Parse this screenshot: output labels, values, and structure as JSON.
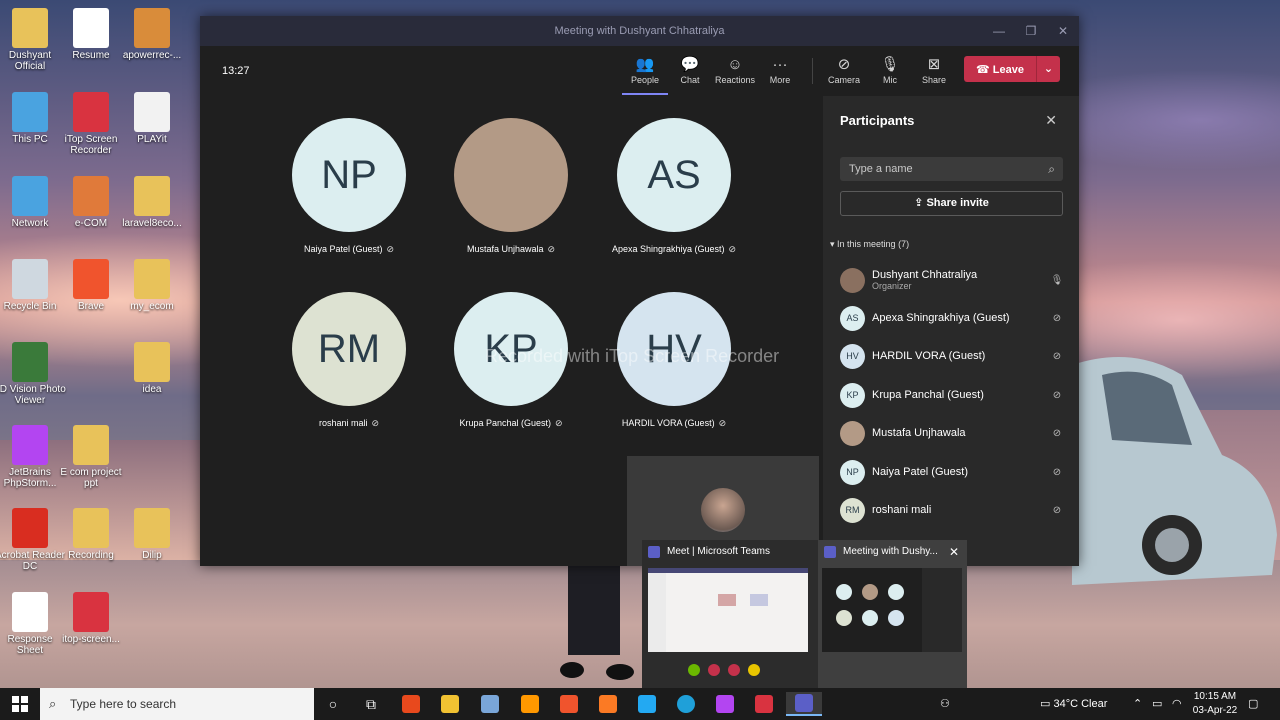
{
  "desktop": {
    "icons": [
      {
        "label": "Dushyant Official",
        "color": "#e8c25a"
      },
      {
        "label": "Resume",
        "color": "#ffffff"
      },
      {
        "label": "apowerrec-...",
        "color": "#d98c3a"
      },
      {
        "label": "This PC",
        "color": "#4aa3e0"
      },
      {
        "label": "iTop Screen Recorder",
        "color": "#d93340"
      },
      {
        "label": "PLAYit",
        "color": "#f2f2f2"
      },
      {
        "label": "Network",
        "color": "#4aa3e0"
      },
      {
        "label": "e-COM",
        "color": "#e07a3a"
      },
      {
        "label": "laravel8eco...",
        "color": "#e8c25a"
      },
      {
        "label": "Recycle Bin",
        "color": "#cfd8e0"
      },
      {
        "label": "Brave",
        "color": "#f0542d"
      },
      {
        "label": "my_ecom",
        "color": "#e8c25a"
      },
      {
        "label": "3D Vision Photo Viewer",
        "color": "#3a7a3a"
      },
      {
        "label": "idea",
        "color": "#e8c25a"
      },
      {
        "label": "JetBrains PhpStorm...",
        "color": "#b345f1"
      },
      {
        "label": "E com project ppt",
        "color": "#e8c25a"
      },
      {
        "label": "Acrobat Reader DC",
        "color": "#d92d20"
      },
      {
        "label": "Recording",
        "color": "#e8c25a"
      },
      {
        "label": "Dilip",
        "color": "#e8c25a"
      },
      {
        "label": "Response Sheet",
        "color": "#ffffff"
      },
      {
        "label": "itop-screen...",
        "color": "#d93340"
      }
    ],
    "icon_glyphs": {
      "ps": "PS"
    }
  },
  "teams": {
    "window_title": "Meeting with Dushyant Chhatraliya",
    "elapsed": "13:27",
    "toolbar": {
      "people": "People",
      "chat": "Chat",
      "reactions": "Reactions",
      "more": "More",
      "camera": "Camera",
      "mic": "Mic",
      "share": "Share",
      "leave": "Leave"
    },
    "tiles": [
      {
        "initials": "NP",
        "name": "Naiya Patel (Guest)",
        "color": "#dceef0"
      },
      {
        "initials": "",
        "name": "Mustafa Unjhawala",
        "color": "#b39a86"
      },
      {
        "initials": "AS",
        "name": "Apexa Shingrakhiya (Guest)",
        "color": "#dceef0"
      },
      {
        "initials": "RM",
        "name": "roshani mali",
        "color": "#dde2d2"
      },
      {
        "initials": "KP",
        "name": "Krupa Panchal (Guest)",
        "color": "#dceef0"
      },
      {
        "initials": "HV",
        "name": "HARDIL VORA (Guest)",
        "color": "#d5e4ef"
      }
    ],
    "watermark": "Recorded with iTop Screen Recorder",
    "participants": {
      "title": "Participants",
      "search_placeholder": "Type a name",
      "invite": "Share invite",
      "section": "In this meeting (7)",
      "list": [
        {
          "initials": "",
          "name": "Dushyant Chhatraliya",
          "role": "Organizer",
          "color": "#8a7060"
        },
        {
          "initials": "AS",
          "name": "Apexa Shingrakhiya (Guest)",
          "role": "",
          "color": "#dceef0"
        },
        {
          "initials": "HV",
          "name": "HARDIL VORA (Guest)",
          "role": "",
          "color": "#d5e4ef"
        },
        {
          "initials": "KP",
          "name": "Krupa Panchal (Guest)",
          "role": "",
          "color": "#dceef0"
        },
        {
          "initials": "",
          "name": "Mustafa Unjhawala",
          "role": "",
          "color": "#b39a86"
        },
        {
          "initials": "NP",
          "name": "Naiya Patel (Guest)",
          "role": "",
          "color": "#dceef0"
        },
        {
          "initials": "RM",
          "name": "roshani mali",
          "role": "",
          "color": "#dde2d2"
        }
      ]
    }
  },
  "taskbar_preview": {
    "card1_title": "Meet | Microsoft Teams",
    "card2_title": "Meeting with Dushy..."
  },
  "taskbar": {
    "search_placeholder": "Type here to search",
    "weather": "34°C  Clear",
    "time": "10:15 AM",
    "date": "03-Apr-22"
  }
}
